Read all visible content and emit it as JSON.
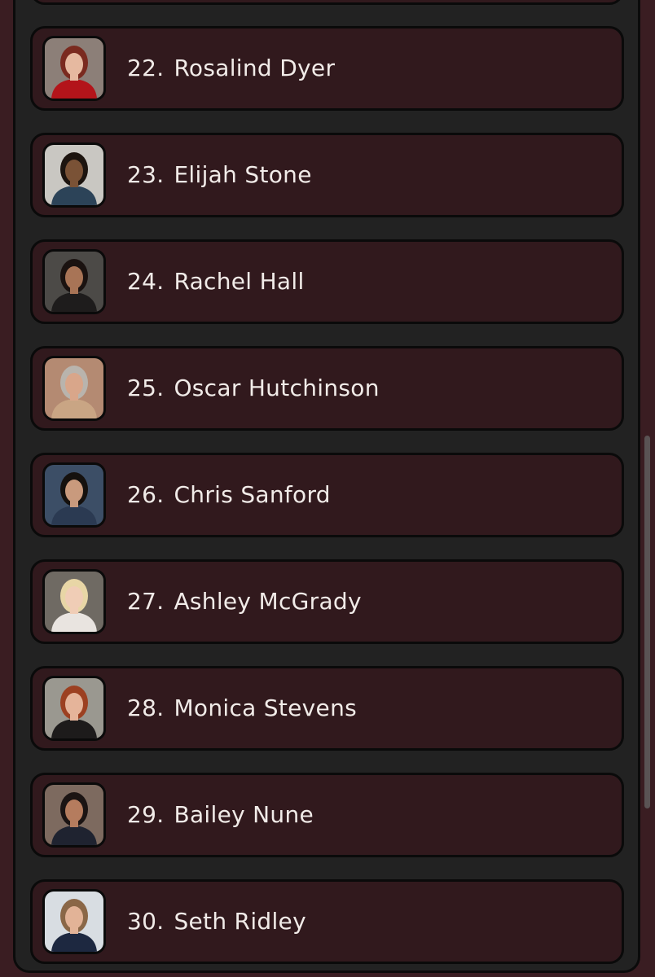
{
  "list": {
    "items": [
      {
        "number": "22.",
        "name": "Rosalind Dyer",
        "avatar_icon": "portrait-woman-red-hair",
        "colors": {
          "bg": "#8c7f78",
          "hair": "#7a2a1f",
          "skin": "#e6b9a0",
          "shirt": "#b3141a"
        }
      },
      {
        "number": "23.",
        "name": "Elijah Stone",
        "avatar_icon": "portrait-man-curly-hair",
        "colors": {
          "bg": "#c9c7c2",
          "hair": "#1c140f",
          "skin": "#7a5236",
          "shirt": "#2c4358"
        }
      },
      {
        "number": "24.",
        "name": "Rachel Hall",
        "avatar_icon": "portrait-woman-dark-hair",
        "colors": {
          "bg": "#4c4a47",
          "hair": "#1a1210",
          "skin": "#a87456",
          "shirt": "#1e1c1c"
        }
      },
      {
        "number": "25.",
        "name": "Oscar Hutchinson",
        "avatar_icon": "portrait-man-grey-hair",
        "colors": {
          "bg": "#b48a72",
          "hair": "#b9b4ad",
          "skin": "#d9a68a",
          "shirt": "#c9a584"
        }
      },
      {
        "number": "26.",
        "name": "Chris Sanford",
        "avatar_icon": "portrait-man-suit",
        "colors": {
          "bg": "#3c4e66",
          "hair": "#15110e",
          "skin": "#c99a7d",
          "shirt": "#2b3a52"
        }
      },
      {
        "number": "27.",
        "name": "Ashley McGrady",
        "avatar_icon": "portrait-woman-blonde",
        "colors": {
          "bg": "#6f6a63",
          "hair": "#e8d6a6",
          "skin": "#f0cdb6",
          "shirt": "#e9e4e0"
        }
      },
      {
        "number": "28.",
        "name": "Monica Stevens",
        "avatar_icon": "portrait-woman-auburn",
        "colors": {
          "bg": "#9a9890",
          "hair": "#9c4021",
          "skin": "#e5b49a",
          "shirt": "#1d1b1b"
        }
      },
      {
        "number": "29.",
        "name": "Bailey Nune",
        "avatar_icon": "portrait-woman-uniform",
        "colors": {
          "bg": "#7d6a5f",
          "hair": "#1b1413",
          "skin": "#b57c5e",
          "shirt": "#1f2330"
        }
      },
      {
        "number": "30.",
        "name": "Seth Ridley",
        "avatar_icon": "portrait-man-police-uniform",
        "colors": {
          "bg": "#d8dde2",
          "hair": "#8a6747",
          "skin": "#e2b397",
          "shirt": "#1d2840"
        }
      }
    ]
  }
}
